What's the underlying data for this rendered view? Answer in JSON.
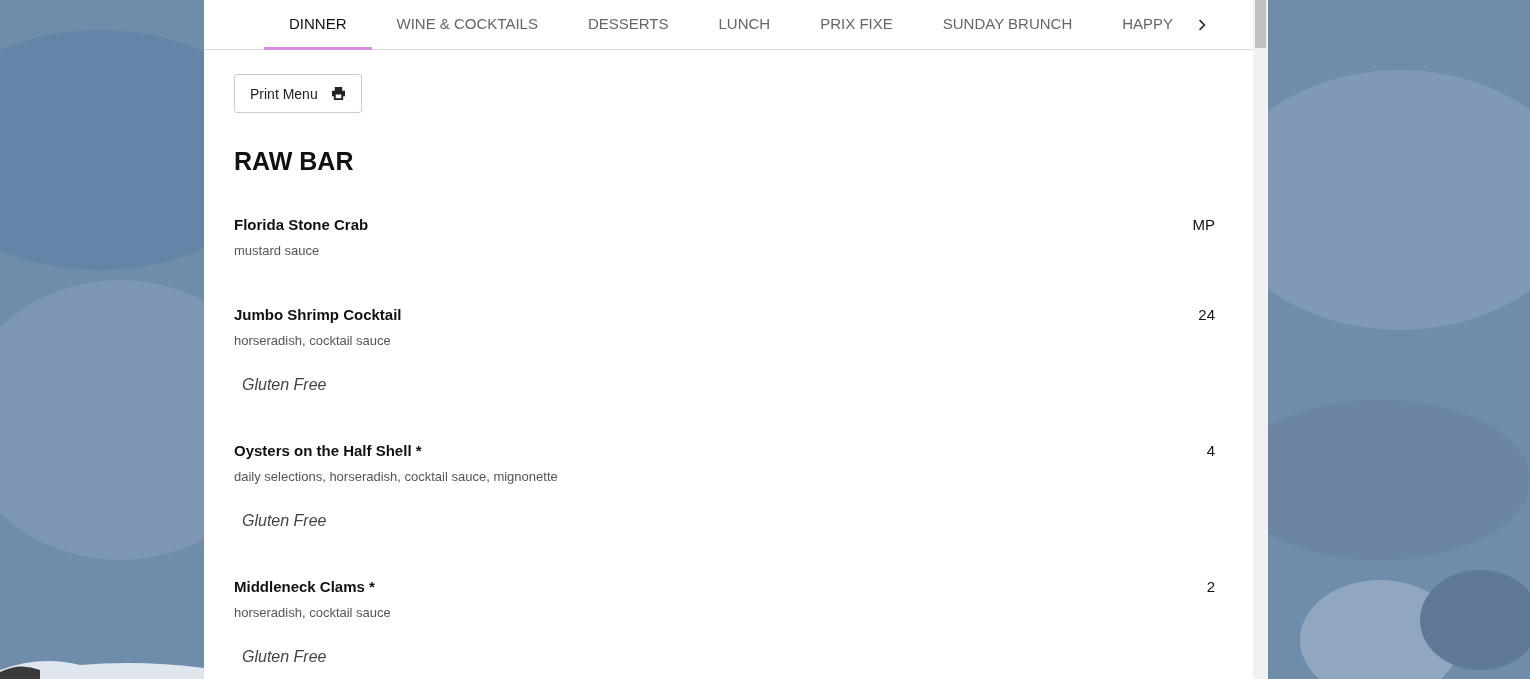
{
  "tabs": [
    {
      "label": "DINNER",
      "selected": true
    },
    {
      "label": "WINE & COCKTAILS",
      "selected": false
    },
    {
      "label": "DESSERTS",
      "selected": false
    },
    {
      "label": "LUNCH",
      "selected": false
    },
    {
      "label": "PRIX FIXE",
      "selected": false
    },
    {
      "label": "SUNDAY BRUNCH",
      "selected": false
    },
    {
      "label": "HAPPY",
      "selected": false
    }
  ],
  "print_button": {
    "label": "Print Menu"
  },
  "section": {
    "title": "RAW BAR",
    "items": [
      {
        "name": "Florida Stone Crab",
        "description": "mustard sauce",
        "price": "MP"
      },
      {
        "name": "Jumbo Shrimp Cocktail",
        "description": "horseradish, cocktail sauce",
        "price": "24",
        "tags": [
          "Gluten Free"
        ]
      },
      {
        "name": "Oysters on the Half Shell *",
        "description": "daily selections, horseradish, cocktail sauce, mignonette",
        "price": "4",
        "tags": [
          "Gluten Free"
        ]
      },
      {
        "name": "Middleneck Clams *",
        "description": "horseradish, cocktail sauce",
        "price": "2",
        "tags": [
          "Gluten Free"
        ]
      }
    ]
  }
}
